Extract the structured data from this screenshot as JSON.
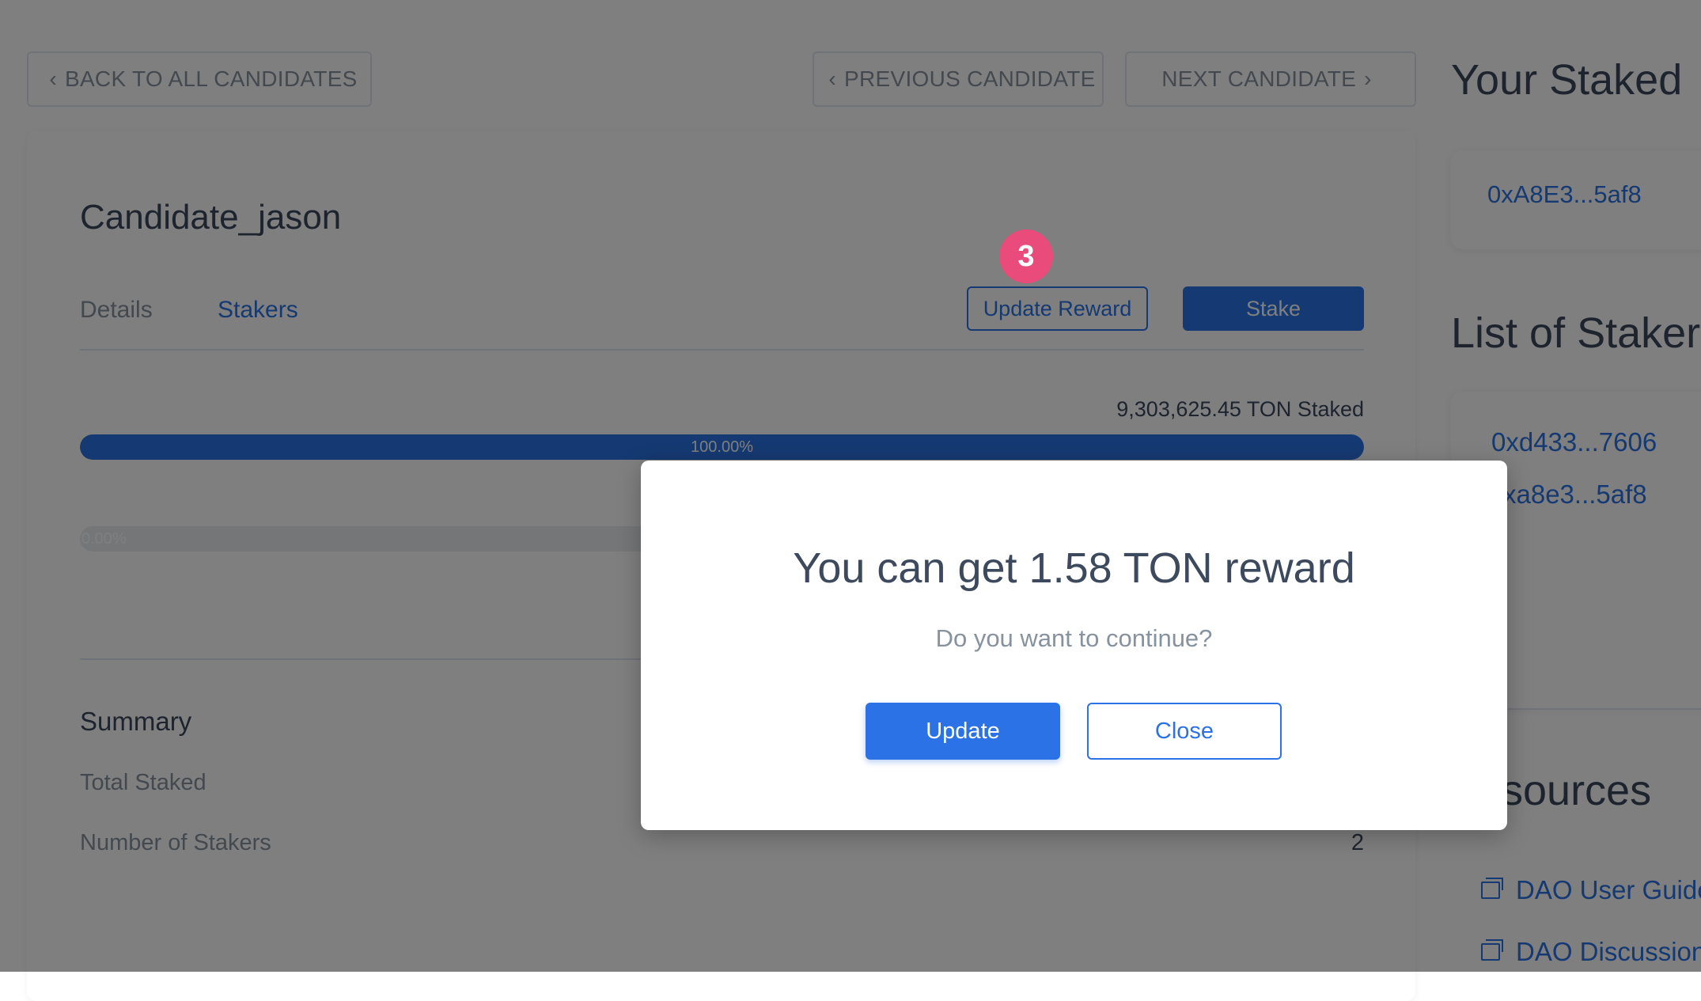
{
  "nav": {
    "back_label": "BACK TO ALL CANDIDATES",
    "prev_label": "PREVIOUS CANDIDATE",
    "next_label": "NEXT CANDIDATE",
    "chevron_left": "‹",
    "chevron_right": "›"
  },
  "candidate": {
    "name": "Candidate_jason",
    "tabs": [
      {
        "label": "Details",
        "active": false
      },
      {
        "label": "Stakers",
        "active": true
      }
    ],
    "update_reward_label": "Update Reward",
    "stake_label": "Stake",
    "staked_text": "9,303,625.45 TON Staked",
    "bars": [
      {
        "label": "100.00%",
        "fraction": 1.0,
        "color": "#2a72e5"
      },
      {
        "label": "0.00%",
        "fraction": 0.0,
        "color": "#c9d1d8"
      }
    ],
    "summary": {
      "title": "Summary",
      "rows": [
        {
          "label": "Total Staked",
          "value": ""
        },
        {
          "label": "Number of Stakers",
          "value": "2"
        }
      ]
    }
  },
  "sidebar": {
    "your_staked_title": "Your Staked",
    "your_staked_address": "0xA8E3...5af8",
    "stakers_title": "List of Staker",
    "stakers": [
      "0xd433...7606",
      "xa8e3...5af8"
    ],
    "resources_title": "sources",
    "resources": [
      "DAO User Guide",
      "DAO Discussion"
    ]
  },
  "step_badge": "3",
  "modal": {
    "title": "You can get 1.58 TON reward",
    "question": "Do you want to continue?",
    "update_label": "Update",
    "close_label": "Close"
  },
  "colors": {
    "accent": "#2a72e5",
    "badge": "#e94b7b",
    "overlay": "rgba(0,0,0,0.5)"
  }
}
